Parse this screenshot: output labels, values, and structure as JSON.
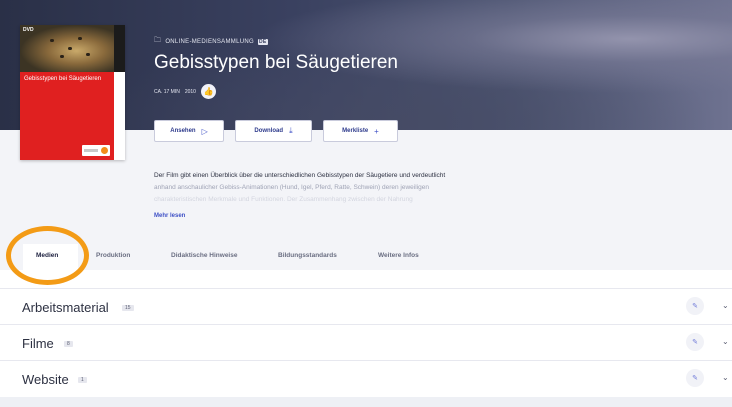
{
  "cover": {
    "dvd_label": "DVD",
    "title": "Gebisstypen bei Säugetieren",
    "colors": {
      "background": "#e02020",
      "accent": "#f28c1a"
    }
  },
  "header": {
    "collection_label": "ONLINE-MEDIENSAMMLUNG",
    "collection_badge": "DE",
    "title": "Gebisstypen bei Säugetieren",
    "duration": "CA. 17 MIN",
    "year": "2010",
    "like_icon": "thumbs-up-icon"
  },
  "actions": [
    {
      "label": "Ansehen",
      "icon": "play-outline-icon"
    },
    {
      "label": "Download",
      "icon": "download-icon"
    },
    {
      "label": "Merkliste",
      "icon": "plus-icon"
    }
  ],
  "description": {
    "line1": "Der Film gibt einen Überblick über die unterschiedlichen Gebisstypen der Säugetiere und verdeutlicht",
    "line2": "anhand anschaulicher Gebiss-Animationen (Hund, Igel, Pferd, Ratte, Schwein) deren jeweiligen",
    "line3": "charakteristischen Merkmale und Funktionen. Der Zusammenhang zwischen der Nahrung",
    "more_label": "Mehr lesen"
  },
  "tabs": [
    "Medien",
    "Produktion",
    "Didaktische Hinweise",
    "Bildungsstandards",
    "Weitere Infos"
  ],
  "sections": [
    {
      "label": "Arbeitsmaterial",
      "count": "15"
    },
    {
      "label": "Filme",
      "count": "8"
    },
    {
      "label": "Website",
      "count": "1"
    }
  ],
  "colors": {
    "accent": "#3f51c6",
    "highlight": "#f39b16",
    "hero": "#3a4160"
  }
}
